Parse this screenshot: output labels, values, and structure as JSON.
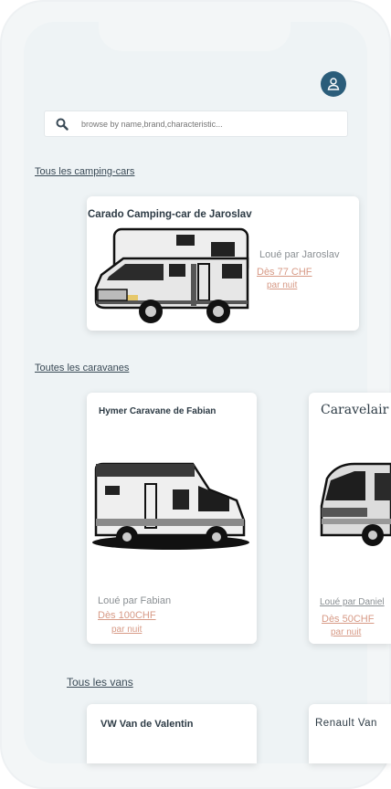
{
  "search": {
    "placeholder": "browse by name,brand,characteristic..."
  },
  "sections": {
    "campers_title": "Tous les camping-cars",
    "caravans_title": "Toutes les caravanes",
    "vans_title": "Tous les vans"
  },
  "campers": [
    {
      "title": "Carado Camping-car de Jaroslav",
      "owner": "Loué par Jaroslav",
      "price": "Dès 77 CHF",
      "unit": "par nuit"
    }
  ],
  "caravans": [
    {
      "title": "Hymer Caravane de Fabian",
      "owner": "Loué par Fabian",
      "price": "Dès 100CHF",
      "unit": "par nuit"
    },
    {
      "title": "Caravelair",
      "owner": "Loué par Daniel",
      "price": "Dès 50CHF",
      "unit": "par nuit"
    }
  ],
  "vans": [
    {
      "title": "VW Van de Valentin"
    },
    {
      "title": "Renault Van"
    }
  ],
  "icons": {
    "avatar": "user-icon",
    "search": "search-icon"
  },
  "colors": {
    "accent": "#2b5d7a",
    "price": "#d79a86"
  }
}
